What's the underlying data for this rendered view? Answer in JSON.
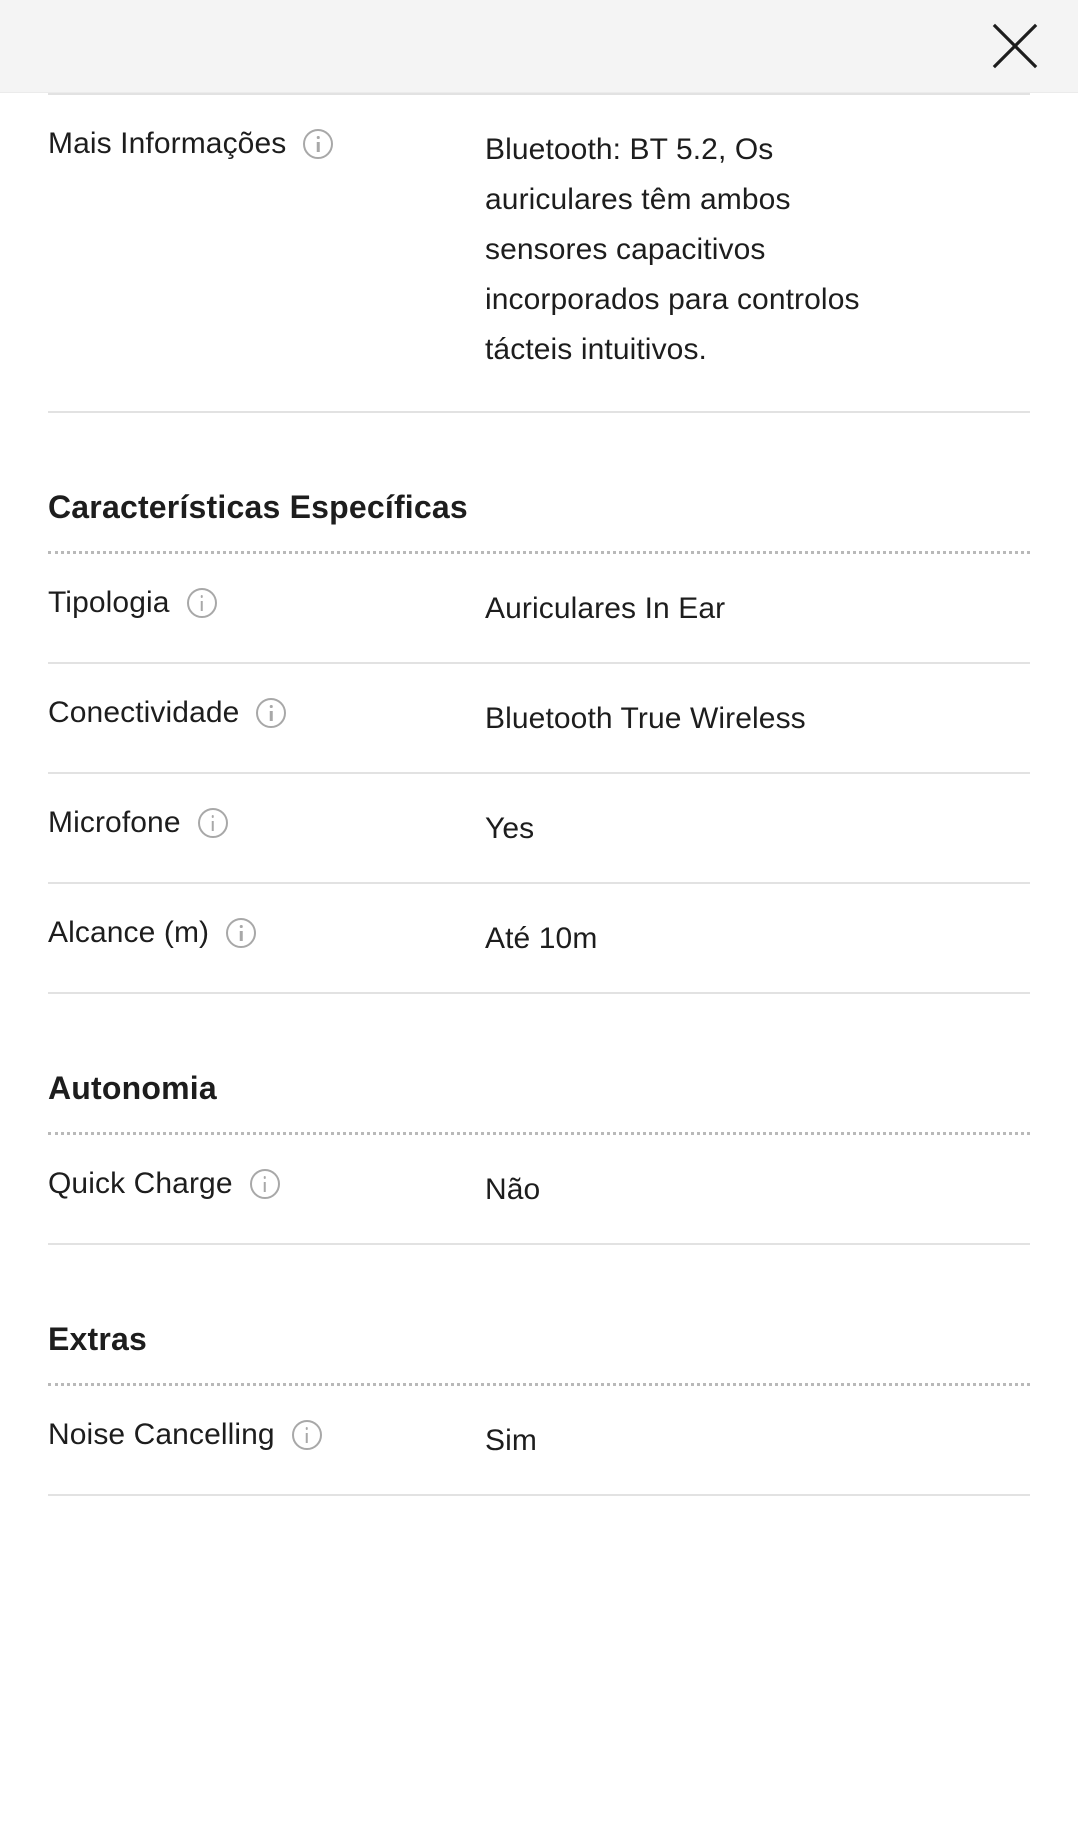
{
  "header": {
    "close_label": "Fechar",
    "close_icon": "close-icon",
    "background_color": "#f4f4f4"
  },
  "info_icon_name": "info-icon",
  "colors": {
    "text": "#1d1d1d",
    "divider": "#e2e2e2",
    "dotted_divider": "#b9b9b9",
    "icon_gray": "#a8a8a8"
  },
  "intro_rows": [
    {
      "label": "Mais Informações",
      "value": "Bluetooth: BT 5.2, Os auriculares têm ambos sensores capacitivos incorporados para controlos tácteis intuitivos."
    }
  ],
  "sections": [
    {
      "title": "Características Específicas",
      "rows": [
        {
          "label": "Tipologia",
          "value": "Auriculares In Ear"
        },
        {
          "label": "Conectividade",
          "value": "Bluetooth True Wireless"
        },
        {
          "label": "Microfone",
          "value": "Yes"
        },
        {
          "label": "Alcance (m)",
          "value": "Até 10m"
        }
      ]
    },
    {
      "title": "Autonomia",
      "rows": [
        {
          "label": "Quick Charge",
          "value": "Não"
        }
      ]
    },
    {
      "title": "Extras",
      "rows": [
        {
          "label": "Noise Cancelling",
          "value": "Sim"
        }
      ]
    }
  ]
}
